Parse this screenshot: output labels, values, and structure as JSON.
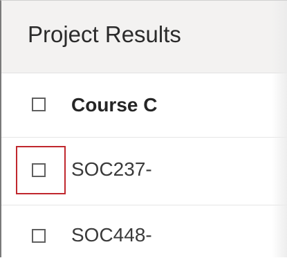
{
  "panel": {
    "title": "Project Results"
  },
  "table": {
    "header": {
      "select_all_checked": false,
      "column_label": "Course C"
    },
    "rows": [
      {
        "checked": false,
        "code": "SOC237-",
        "focused": true
      },
      {
        "checked": false,
        "code": "SOC448-",
        "focused": false
      }
    ]
  },
  "colors": {
    "focus_ring": "#c0272d",
    "header_background": "#f3f2f1"
  }
}
